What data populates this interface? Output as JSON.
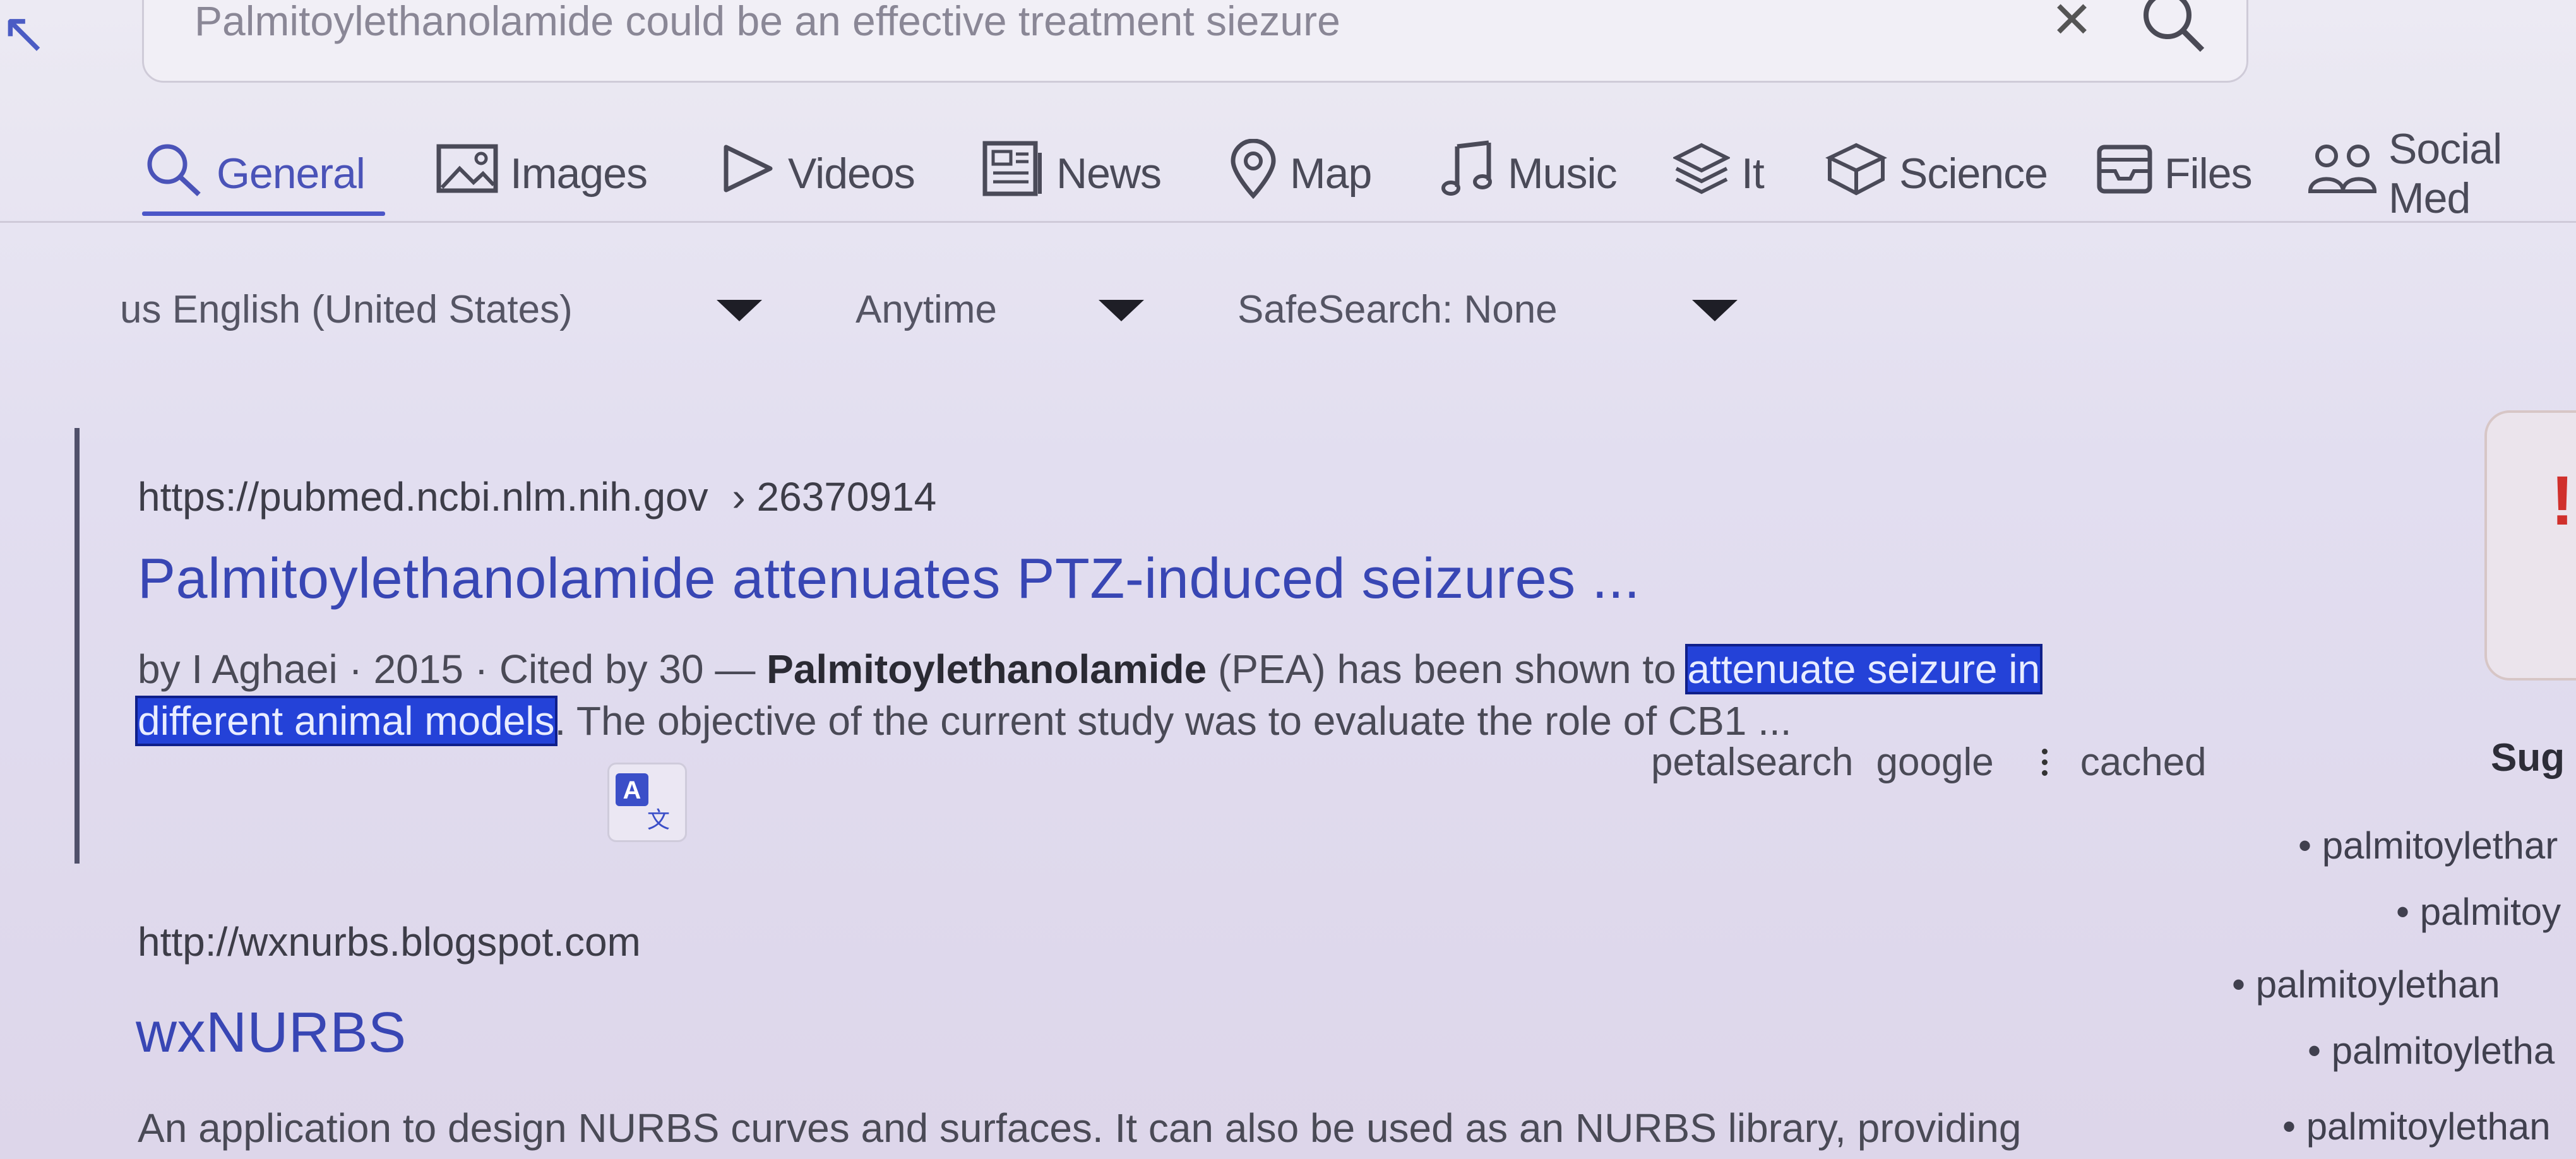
{
  "search": {
    "query": "Palmitoylethanolamide could be an effective treatment siezure"
  },
  "tabs": [
    {
      "label": "General",
      "icon": "search-icon",
      "active": true
    },
    {
      "label": "Images",
      "icon": "image-icon"
    },
    {
      "label": "Videos",
      "icon": "play-icon"
    },
    {
      "label": "News",
      "icon": "newspaper-icon"
    },
    {
      "label": "Map",
      "icon": "map-pin-icon"
    },
    {
      "label": "Music",
      "icon": "music-note-icon"
    },
    {
      "label": "It",
      "icon": "layers-icon"
    },
    {
      "label": "Science",
      "icon": "cube-icon"
    },
    {
      "label": "Files",
      "icon": "inbox-icon"
    },
    {
      "label": "Social Med",
      "icon": "people-icon"
    }
  ],
  "filters": {
    "language": "us English (United States)",
    "time": "Anytime",
    "safesearch": "SafeSearch: None"
  },
  "results": [
    {
      "url": "https://pubmed.ncbi.nlm.nih.gov",
      "path": "› 26370914",
      "title": "Palmitoylethanolamide attenuates PTZ-induced seizures ...",
      "meta": "by I Aghaei · 2015 · Cited by 30 — ",
      "bold_term": "Palmitoylethanolamide",
      "text_a": " (PEA) has been shown to ",
      "highlight_1": "attenuate seizure in",
      "highlight_2": "different animal models",
      "text_b": ". The objective of the current study was to evaluate the role of CB1 ...",
      "links": [
        "petalsearch",
        "google",
        "cached"
      ]
    },
    {
      "url": "http://wxnurbs.blogspot.com",
      "title": "wxNURBS",
      "snippet": "An application to design NURBS curves and surfaces. It can also be used as an NURBS library, providing"
    }
  ],
  "sidebar": {
    "heading": "Sug",
    "suggestions": [
      "palmitoylethar",
      "palmitoy",
      "palmitoylethan",
      "palmitoyletha",
      "palmitoylethan"
    ]
  },
  "colors": {
    "accent": "#4b56c8",
    "highlight": "#2442d8",
    "link": "#3846b4"
  }
}
